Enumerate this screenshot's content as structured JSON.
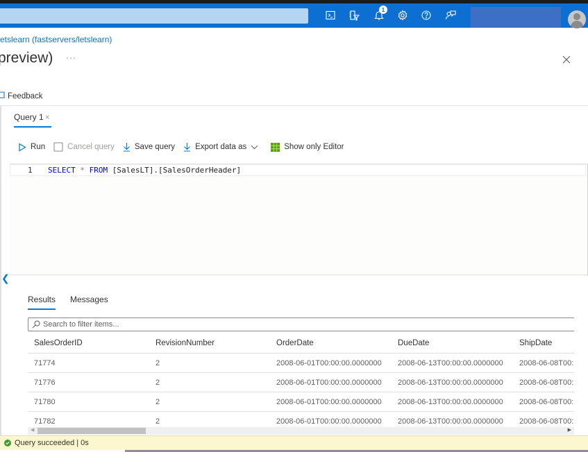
{
  "topbar": {
    "search_placeholder": "",
    "icons": [
      {
        "name": "cloud-shell-icon",
        "label": "Cloud Shell"
      },
      {
        "name": "directory-filter-icon",
        "label": "Directories + subscriptions"
      },
      {
        "name": "notifications-icon",
        "label": "Notifications",
        "badge": "1"
      },
      {
        "name": "settings-icon",
        "label": "Settings"
      },
      {
        "name": "help-icon",
        "label": "Help"
      },
      {
        "name": "feedback-person-icon",
        "label": "Feedback"
      }
    ],
    "brand_color": "#0c6fd1"
  },
  "header": {
    "breadcrumb": "etslearn (fastservers/letslearn)",
    "title": "preview)",
    "more": "···"
  },
  "feedback": {
    "label": "Feedback"
  },
  "query_tab": {
    "label": "Query 1",
    "close": "×"
  },
  "toolbar": {
    "run": "Run",
    "cancel": "Cancel query",
    "save": "Save query",
    "export": "Export data as",
    "show_editor": "Show only Editor"
  },
  "editor": {
    "line_number": "1",
    "code": {
      "kw1": "SELECT",
      "star": " * ",
      "kw2": "FROM",
      "rest": " [SalesLT].[SalesOrderHeader]"
    }
  },
  "results": {
    "tabs": [
      "Results",
      "Messages"
    ],
    "active_tab": "Results",
    "filter_placeholder": "Search to filter items...",
    "columns": [
      "SalesOrderID",
      "RevisionNumber",
      "OrderDate",
      "DueDate",
      "ShipDate"
    ],
    "rows": [
      [
        "71774",
        "2",
        "2008-06-01T00:00:00.0000000",
        "2008-06-13T00:00:00.0000000",
        "2008-06-08T00:"
      ],
      [
        "71776",
        "2",
        "2008-06-01T00:00:00.0000000",
        "2008-06-13T00:00:00.0000000",
        "2008-06-08T00:"
      ],
      [
        "71780",
        "2",
        "2008-06-01T00:00:00.0000000",
        "2008-06-13T00:00:00.0000000",
        "2008-06-08T00:"
      ],
      [
        "71782",
        "2",
        "2008-06-01T00:00:00.0000000",
        "2008-06-13T00:00:00.0000000",
        "2008-06-08T00:"
      ]
    ]
  },
  "status": {
    "text": "Query succeeded | 0s",
    "color": "#3f9c35"
  }
}
